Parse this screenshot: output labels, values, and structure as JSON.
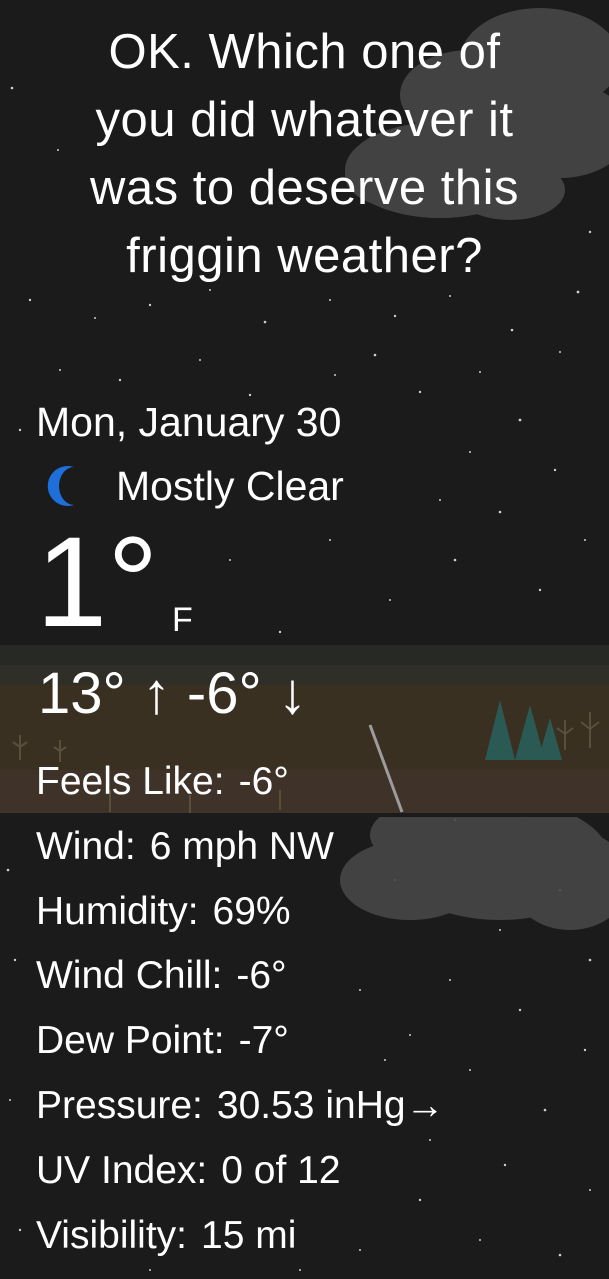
{
  "headline": {
    "line1": "OK. Which one of",
    "line2": "you did whatever it",
    "line3": "was to deserve this",
    "line4": "friggin weather?"
  },
  "date": "Mon, January 30",
  "condition": {
    "text": "Mostly Clear",
    "icon": "crescent-moon-icon",
    "icon_color": "#1e6fd9"
  },
  "temperature": {
    "current": "1°",
    "unit": "F",
    "high_low": "13° ↑ -6° ↓"
  },
  "details": [
    {
      "label": "Feels Like:",
      "value": "-6°"
    },
    {
      "label": "Wind:",
      "value": "6 mph NW"
    },
    {
      "label": "Humidity:",
      "value": "69%"
    },
    {
      "label": "Wind Chill:",
      "value": "-6°"
    },
    {
      "label": "Dew Point:",
      "value": "-7°"
    },
    {
      "label": "Pressure:",
      "value": "30.53 inHg→"
    },
    {
      "label": "UV Index:",
      "value": "0 of 12"
    },
    {
      "label": "Visibility:",
      "value": "15 mi"
    }
  ],
  "colors": {
    "sky": "#1b1b1b",
    "text": "#ffffff",
    "cloud": "#4a4a4a",
    "ground": "#3b3124"
  }
}
